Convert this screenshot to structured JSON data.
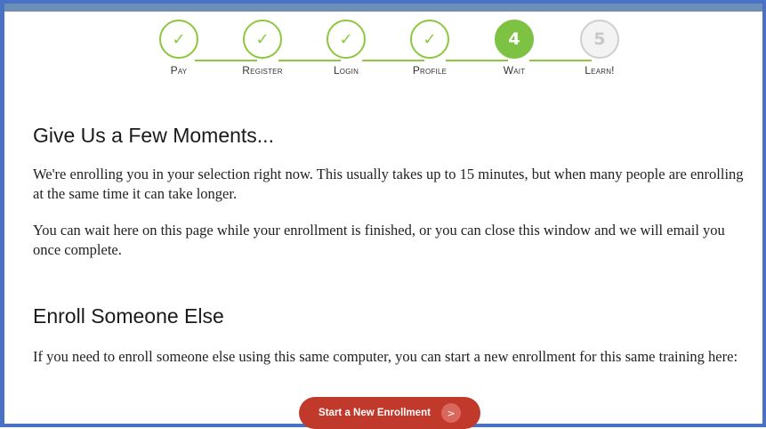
{
  "steps": [
    {
      "label": "Pay",
      "icon": "check-icon",
      "status": "done"
    },
    {
      "label": "Register",
      "icon": "check-icon",
      "status": "done"
    },
    {
      "label": "Login",
      "icon": "check-icon",
      "status": "done"
    },
    {
      "label": "Profile",
      "icon": "check-icon",
      "status": "done"
    },
    {
      "label": "Wait",
      "number": "4",
      "status": "current"
    },
    {
      "label": "Learn!",
      "number": "5",
      "status": "pending"
    }
  ],
  "check_glyph": "✓",
  "colors": {
    "accent_green": "#8dc63f",
    "current_green": "#7dc242",
    "cta_red": "#c0392b",
    "frame_blue": "#4a72c4"
  },
  "section1": {
    "heading": "Give Us a Few Moments...",
    "para1": "We're enrolling you in your selection right now. This usually takes up to 15 minutes, but when many people are enrolling at the same time it can take longer.",
    "para2": "You can wait here on this page while your enrollment is finished, or you can close this window and we will email you once complete."
  },
  "section2": {
    "heading": "Enroll Someone Else",
    "para": "If you need to enroll someone else using this same computer, you can start a new enrollment for this same training here:"
  },
  "cta": {
    "label": "Start a New Enrollment",
    "arrow": ">"
  }
}
